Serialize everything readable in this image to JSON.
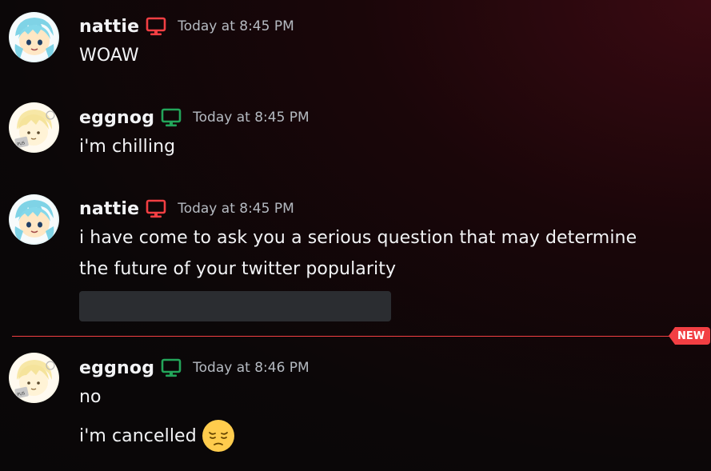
{
  "colors": {
    "divider": "#f23f43",
    "desktop_icon_nattie": "#f23f43",
    "desktop_icon_eggnog": "#23a55a",
    "timestamp": "#b5bac1"
  },
  "messages": [
    {
      "author": "nattie",
      "device_icon": "desktop-icon",
      "timestamp": "Today at 8:45 PM",
      "lines": [
        "WOAW"
      ]
    },
    {
      "author": "eggnog",
      "device_icon": "desktop-icon",
      "timestamp": "Today at 8:45 PM",
      "lines": [
        "i'm chilling"
      ]
    },
    {
      "author": "nattie",
      "device_icon": "desktop-icon",
      "timestamp": "Today at 8:45 PM",
      "lines": [
        "i have come to ask you a serious question that may determine",
        "the future of your twitter popularity"
      ],
      "attachment": "spoiler"
    },
    {
      "author": "eggnog",
      "device_icon": "desktop-icon",
      "timestamp": "Today at 8:46 PM",
      "lines": [
        "no",
        "i'm cancelled"
      ],
      "emoji": "pensive-face"
    }
  ],
  "new_divider": {
    "label": "NEW"
  }
}
